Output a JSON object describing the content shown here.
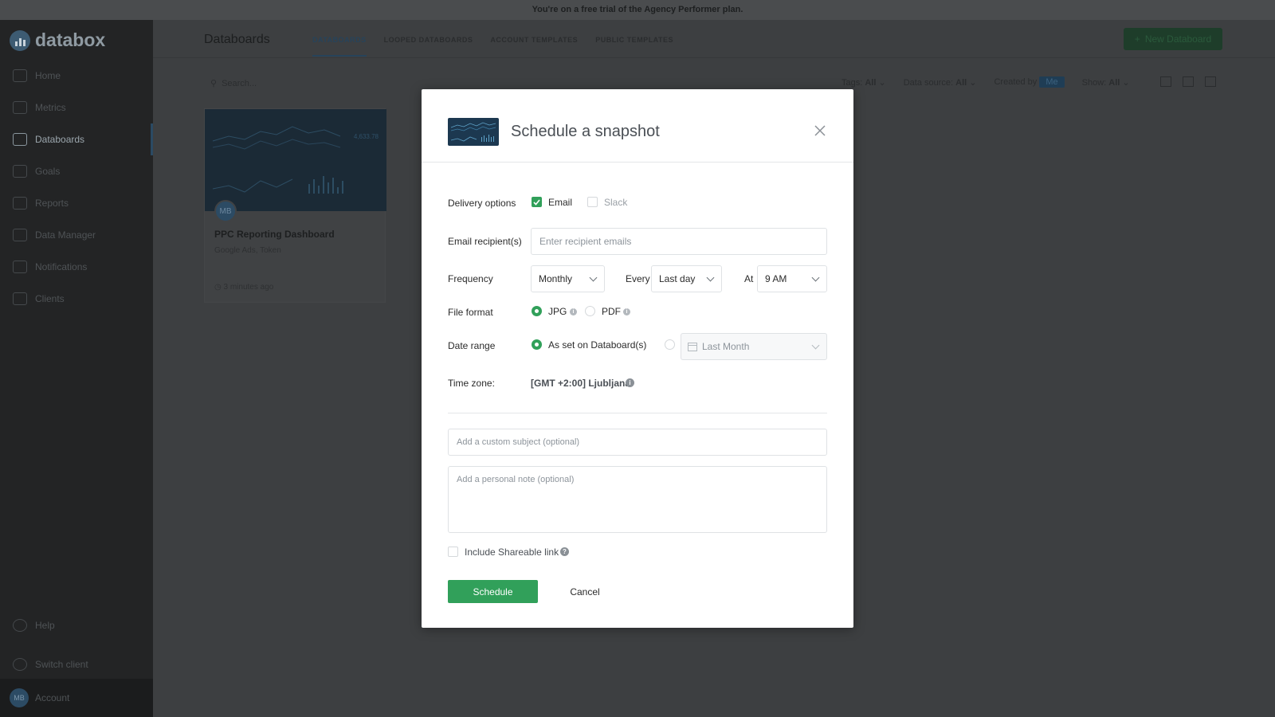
{
  "banner": {
    "text": "You're on a free trial of the Agency Performer plan."
  },
  "app": {
    "logo_text": "databox",
    "nav": [
      {
        "label": "Home",
        "icon": "home-icon"
      },
      {
        "label": "Metrics",
        "icon": "metrics-icon"
      },
      {
        "label": "Databoards",
        "icon": "databoards-icon",
        "active": true
      },
      {
        "label": "Goals",
        "icon": "goals-icon"
      },
      {
        "label": "Reports",
        "icon": "reports-icon"
      },
      {
        "label": "Data Manager",
        "icon": "data-manager-icon"
      },
      {
        "label": "Notifications",
        "icon": "notifications-icon"
      },
      {
        "label": "Clients",
        "icon": "clients-icon"
      }
    ],
    "bottom_nav": [
      {
        "label": "Help",
        "icon": "help-icon"
      },
      {
        "label": "Switch client",
        "icon": "switch-client-icon"
      }
    ],
    "account": {
      "initials": "MB",
      "label": "Account"
    }
  },
  "page": {
    "title": "Databoards",
    "tabs": [
      "DATABOARDS",
      "LOOPED DATABOARDS",
      "ACCOUNT TEMPLATES",
      "PUBLIC TEMPLATES"
    ],
    "new_button": "New Databoard",
    "search_placeholder": "Search...",
    "filters": {
      "tags_label": "Tags:",
      "tags_value": "All",
      "source_label": "Data source:",
      "source_value": "All",
      "created_label": "Created by",
      "created_value": "Me",
      "show_label": "Show:",
      "show_value": "All"
    }
  },
  "card": {
    "initials": "MB",
    "title": "PPC Reporting Dashboard",
    "subtitle": "Google Ads, Token",
    "time": "3 minutes ago",
    "thumb_value": "4,633.78"
  },
  "modal": {
    "title": "Schedule a snapshot",
    "delivery": {
      "label": "Delivery options",
      "email": "Email",
      "email_checked": true,
      "slack": "Slack",
      "slack_checked": false
    },
    "recipients": {
      "label": "Email recipient(s)",
      "placeholder": "Enter recipient emails"
    },
    "frequency": {
      "label": "Frequency",
      "value": "Monthly",
      "every_label": "Every",
      "every_value": "Last day",
      "at_label": "At",
      "at_value": "9 AM"
    },
    "file_format": {
      "label": "File format",
      "jpg": "JPG",
      "pdf": "PDF",
      "selected": "JPG"
    },
    "date_range": {
      "label": "Date range",
      "option_databoard": "As set on Databoard(s)",
      "option_custom": "Last Month"
    },
    "timezone": {
      "label": "Time zone:",
      "value": "[GMT +2:00] Ljubljana"
    },
    "subject_placeholder": "Add a custom subject (optional)",
    "note_placeholder": "Add a personal note (optional)",
    "shareable_link": {
      "label": "Include Shareable link",
      "checked": false
    },
    "schedule_button": "Schedule",
    "cancel_button": "Cancel"
  },
  "colors": {
    "accent": "#31a05a",
    "overlay": "#3d3f41",
    "sidebar": "#232425"
  }
}
